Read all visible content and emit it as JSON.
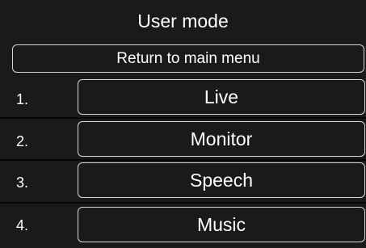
{
  "screen": {
    "title": "User mode",
    "return_label": "Return to main menu"
  },
  "modes": [
    {
      "number": "1.",
      "label": "Live"
    },
    {
      "number": "2.",
      "label": "Monitor"
    },
    {
      "number": "3.",
      "label": "Speech"
    },
    {
      "number": "4.",
      "label": "Music"
    }
  ],
  "colors": {
    "background": "#1a1a1a",
    "text": "#ffffff",
    "button_border": "#d8d8d8"
  }
}
